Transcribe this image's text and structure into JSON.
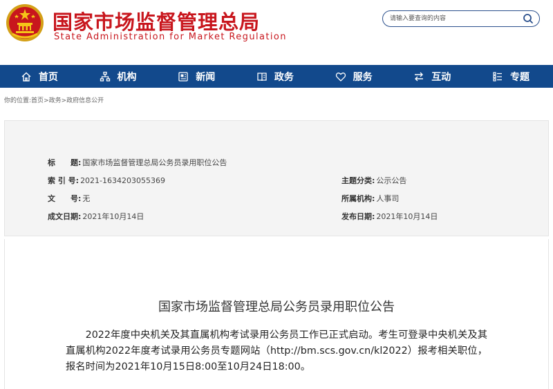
{
  "header": {
    "site_name_cn": "国家市场监督管理总局",
    "site_name_en": "State Administration for Market Regulation",
    "search_placeholder": "请输入要查询的内容"
  },
  "nav": {
    "items": [
      {
        "label": "首页",
        "icon": "home-icon"
      },
      {
        "label": "机构",
        "icon": "org-icon"
      },
      {
        "label": "新闻",
        "icon": "news-icon"
      },
      {
        "label": "政务",
        "icon": "affairs-icon"
      },
      {
        "label": "服务",
        "icon": "heart-icon"
      },
      {
        "label": "互动",
        "icon": "exchange-icon"
      },
      {
        "label": "专题",
        "icon": "topics-icon"
      }
    ]
  },
  "breadcrumb": {
    "prefix": "你的位置:",
    "items": [
      "首页",
      "政务",
      "政府信息公开"
    ],
    "separator": ">"
  },
  "info": {
    "title_label": "标　　题:",
    "title_value": "国家市场监督管理总局公务员录用职位公告",
    "index_label": "索 引 号:",
    "index_value": "2021-1634203055369",
    "category_label": "主题分类:",
    "category_value": "公示公告",
    "docno_label": "文　　号:",
    "docno_value": "无",
    "org_label": "所属机构:",
    "org_value": "人事司",
    "created_label": "成文日期:",
    "created_value": "2021年10月14日",
    "published_label": "发布日期:",
    "published_value": "2021年10月14日"
  },
  "article": {
    "title": "国家市场监督管理总局公务员录用职位公告",
    "paragraph": "2022年度中央机关及其直属机构考试录用公务员工作已正式启动。考生可登录中央机关及其直属机构2022年度考试录用公务员专题网站（http://bm.scs.gov.cn/kl2022）报考相关职位，报名时间为2021年10月15日8:00至10月24日18:00。"
  },
  "colors": {
    "brand_red": "#c8161d",
    "nav_blue": "#12498c"
  }
}
